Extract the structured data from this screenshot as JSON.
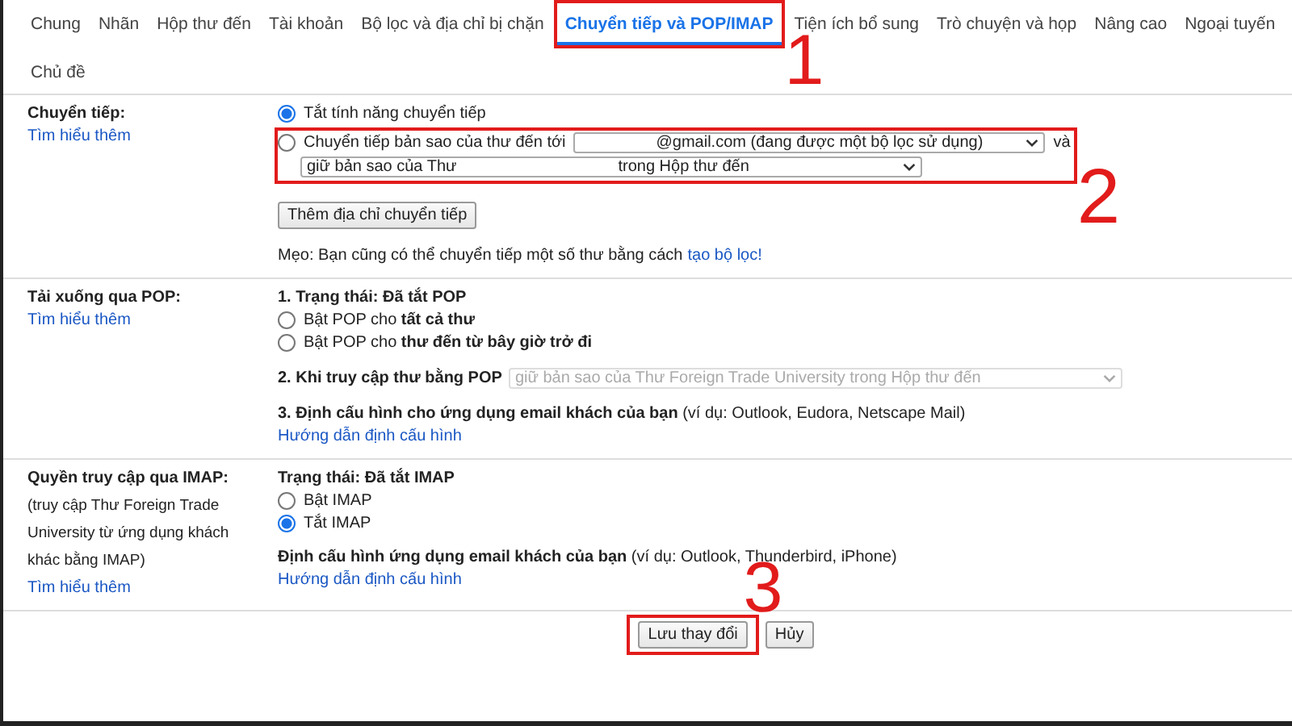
{
  "tabs": [
    {
      "label": "Chung",
      "selected": false
    },
    {
      "label": "Nhãn",
      "selected": false
    },
    {
      "label": "Hộp thư đến",
      "selected": false
    },
    {
      "label": "Tài khoản",
      "selected": false
    },
    {
      "label": "Bộ lọc và địa chỉ bị chặn",
      "selected": false
    },
    {
      "label": "Chuyển tiếp và POP/IMAP",
      "selected": true,
      "annotation": "1"
    },
    {
      "label": "Tiện ích bổ sung",
      "selected": false
    },
    {
      "label": "Trò chuyện và họp",
      "selected": false
    },
    {
      "label": "Nâng cao",
      "selected": false
    },
    {
      "label": "Ngoại tuyến",
      "selected": false
    },
    {
      "label": "Chủ đề",
      "selected": false
    }
  ],
  "forwarding": {
    "label": "Chuyển tiếp:",
    "learn_more": "Tìm hiểu thêm",
    "annotation": "2",
    "off_option": {
      "label": "Tắt tính năng chuyển tiếp",
      "selected": true
    },
    "forward_option": {
      "label": "Chuyển tiếp bản sao của thư đến tới",
      "selected": false,
      "address_select": "@gmail.com (đang được một bộ lọc sử dụng)",
      "conjunction": "và",
      "keep_select_start": "giữ bản sao của Thư",
      "keep_select_end": "trong Hộp thư đến"
    },
    "add_button": "Thêm địa chỉ chuyển tiếp",
    "tip": "Mẹo: Bạn cũng có thể chuyển tiếp một số thư bằng cách",
    "tip_link": "tạo bộ lọc!"
  },
  "pop": {
    "label": "Tải xuống qua POP:",
    "learn_more": "Tìm hiểu thêm",
    "status": "1. Trạng thái: Đã tắt POP",
    "options": [
      {
        "label": "Bật POP cho **tất cả thư**",
        "selected": false
      },
      {
        "label": "Bật POP cho **thư đến từ bây giờ trở đi**",
        "selected": false
      }
    ],
    "access_label": "2. Khi truy cập thư bằng POP",
    "access_select": {
      "value": "giữ bản sao của Thư Foreign Trade University trong Hộp thư đến",
      "disabled": true
    },
    "config": "**3. Định cấu hình cho ứng dụng email khách của bạn** (ví dụ: Outlook, Eudora, Netscape Mail)",
    "config_link": "Hướng dẫn định cấu hình"
  },
  "imap": {
    "label": "Quyền truy cập qua IMAP:",
    "note": "(truy cập Thư Foreign Trade University từ ứng dụng khách khác bằng IMAP)",
    "learn_more": "Tìm hiểu thêm",
    "status": "Trạng thái: Đã tắt IMAP",
    "options": [
      {
        "label": "Bật IMAP",
        "selected": false
      },
      {
        "label": "Tắt IMAP",
        "selected": true
      }
    ],
    "config": "**Định cấu hình ứng dụng email khách của bạn** (ví dụ: Outlook, Thunderbird, iPhone)",
    "config_link": "Hướng dẫn định cấu hình"
  },
  "buttons": [
    {
      "label": "Lưu thay đổi",
      "annotation": "3"
    },
    {
      "label": "Hủy"
    }
  ]
}
